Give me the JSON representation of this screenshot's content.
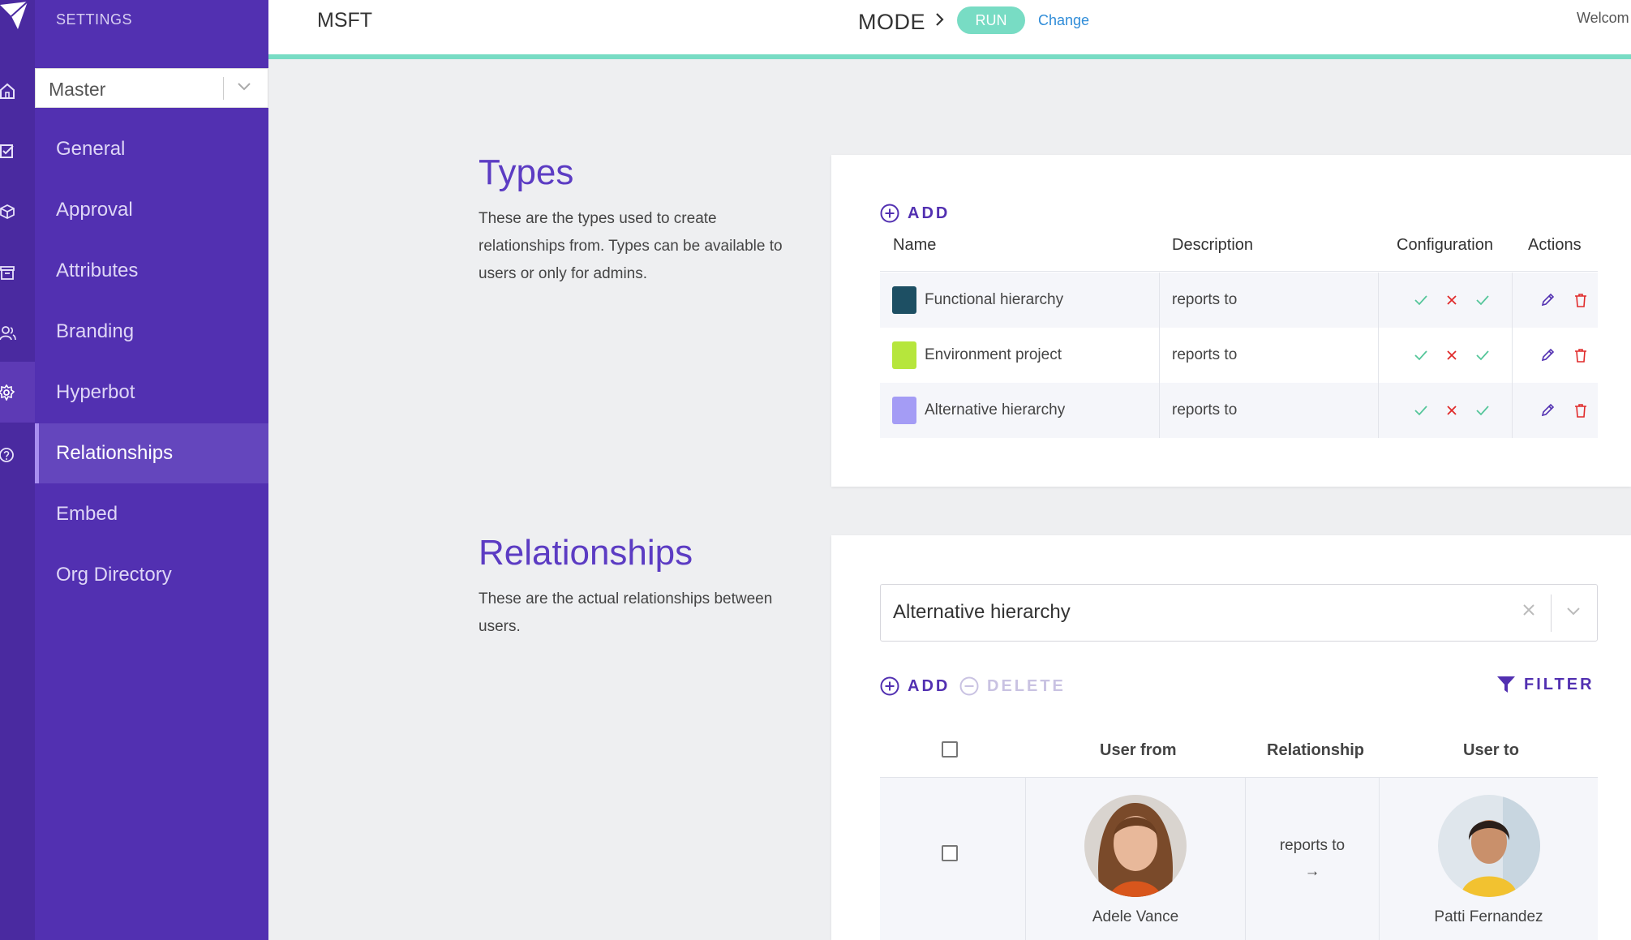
{
  "nav": {
    "section_title": "SETTINGS",
    "environment_select": "Master",
    "items": [
      {
        "label": "General"
      },
      {
        "label": "Approval"
      },
      {
        "label": "Attributes"
      },
      {
        "label": "Branding"
      },
      {
        "label": "Hyperbot"
      },
      {
        "label": "Relationships"
      },
      {
        "label": "Embed"
      },
      {
        "label": "Org Directory"
      }
    ],
    "active_item": "Relationships",
    "rail_icons": [
      "logo-icon",
      "home-icon",
      "checklist-icon",
      "cube-icon",
      "archive-icon",
      "users-icon",
      "gear-icon",
      "help-icon"
    ]
  },
  "header": {
    "org": "MSFT",
    "mode_label": "MODE",
    "mode_value": "RUN",
    "change_link": "Change",
    "welcome": "Welcom"
  },
  "types_section": {
    "title": "Types",
    "description": "These are the types used to create relationships from. Types can be available to users or only for admins.",
    "add_label": "ADD",
    "columns": [
      "Name",
      "Description",
      "Configuration",
      "Actions"
    ],
    "rows": [
      {
        "name": "Functional hierarchy",
        "color": "#1d4f63",
        "description": "reports to",
        "config": [
          "check",
          "cross",
          "check"
        ]
      },
      {
        "name": "Environment project",
        "color": "#b6e63c",
        "description": "reports to",
        "config": [
          "check",
          "cross",
          "check"
        ]
      },
      {
        "name": "Alternative hierarchy",
        "color": "#a49cf5",
        "description": "reports to",
        "config": [
          "check",
          "cross",
          "check"
        ]
      }
    ]
  },
  "relationships_section": {
    "title": "Relationships",
    "description": "These are the actual relationships between users.",
    "type_select": "Alternative hierarchy",
    "add_label": "ADD",
    "delete_label": "DELETE",
    "filter_label": "FILTER",
    "columns": [
      "User from",
      "Relationship",
      "User to"
    ],
    "rows": [
      {
        "user_from": "Adele Vance",
        "relationship": "reports to",
        "arrow": "→",
        "user_to": "Patti Fernandez"
      }
    ]
  },
  "colors": {
    "accent": "#5230b1",
    "nav_bg": "#5230b1",
    "rail_bg": "#4a2aa0",
    "mint": "#78dcc4",
    "link": "#2f8cd8",
    "check": "#55c69a",
    "cross": "#e02a2a"
  }
}
